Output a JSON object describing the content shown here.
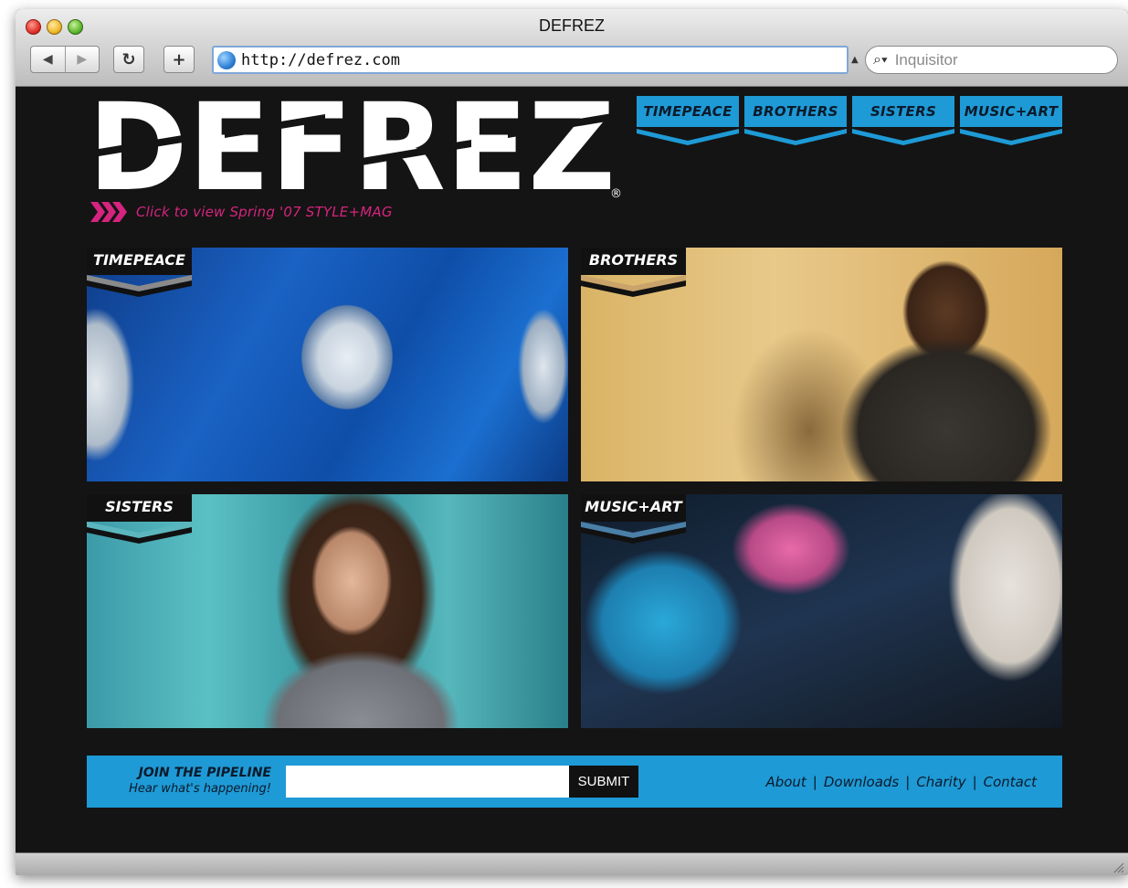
{
  "browser": {
    "window_title": "DEFREZ",
    "url": "http://defrez.com",
    "search_placeholder": "Inquisitor"
  },
  "site": {
    "logo_text": "DEFREZ",
    "registered_mark": "®",
    "mag_link": "Click to view Spring '07 STYLE+MAG",
    "nav": [
      {
        "label": "TIMEPEACE"
      },
      {
        "label": "BROTHERS"
      },
      {
        "label": "SISTERS"
      },
      {
        "label": "MUSIC+ART"
      }
    ],
    "panels": [
      {
        "label": "TIMEPEACE",
        "tag_color": "#8a8a8a"
      },
      {
        "label": "BROTHERS",
        "tag_color": "#c9a36a"
      },
      {
        "label": "SISTERS",
        "tag_color": "#5bb7bd"
      },
      {
        "label": "MUSIC+ART",
        "tag_color": "#4a7fa8"
      }
    ],
    "footer": {
      "join_line1": "JOIN THE PIPELINE",
      "join_line2": "Hear what's happening!",
      "submit_label": "SUBMIT",
      "links": [
        "About",
        "Downloads",
        "Charity",
        "Contact"
      ],
      "link_separator": "|"
    },
    "colors": {
      "accent_blue": "#1e9ad6",
      "mag_pink": "#d5247f",
      "background": "#141414"
    }
  }
}
